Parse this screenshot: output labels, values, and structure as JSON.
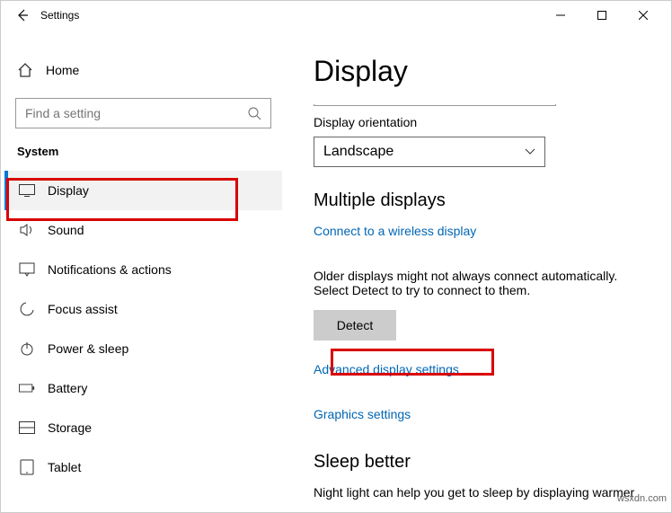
{
  "title": "Settings",
  "home_label": "Home",
  "search_placeholder": "Find a setting",
  "group": "System",
  "nav": [
    {
      "label": "Display",
      "active": true
    },
    {
      "label": "Sound"
    },
    {
      "label": "Notifications & actions"
    },
    {
      "label": "Focus assist"
    },
    {
      "label": "Power & sleep"
    },
    {
      "label": "Battery"
    },
    {
      "label": "Storage"
    },
    {
      "label": "Tablet"
    }
  ],
  "page": {
    "heading": "Display",
    "orientation_label": "Display orientation",
    "orientation_value": "Landscape",
    "multi_heading": "Multiple displays",
    "wireless_link": "Connect to a wireless display",
    "detect_text": "Older displays might not always connect automatically. Select Detect to try to connect to them.",
    "detect_button": "Detect",
    "advanced_link": "Advanced display settings",
    "graphics_link": "Graphics settings",
    "sleep_heading": "Sleep better",
    "sleep_text": "Night light can help you get to sleep by displaying warmer"
  },
  "watermark": "wsxdn.com"
}
